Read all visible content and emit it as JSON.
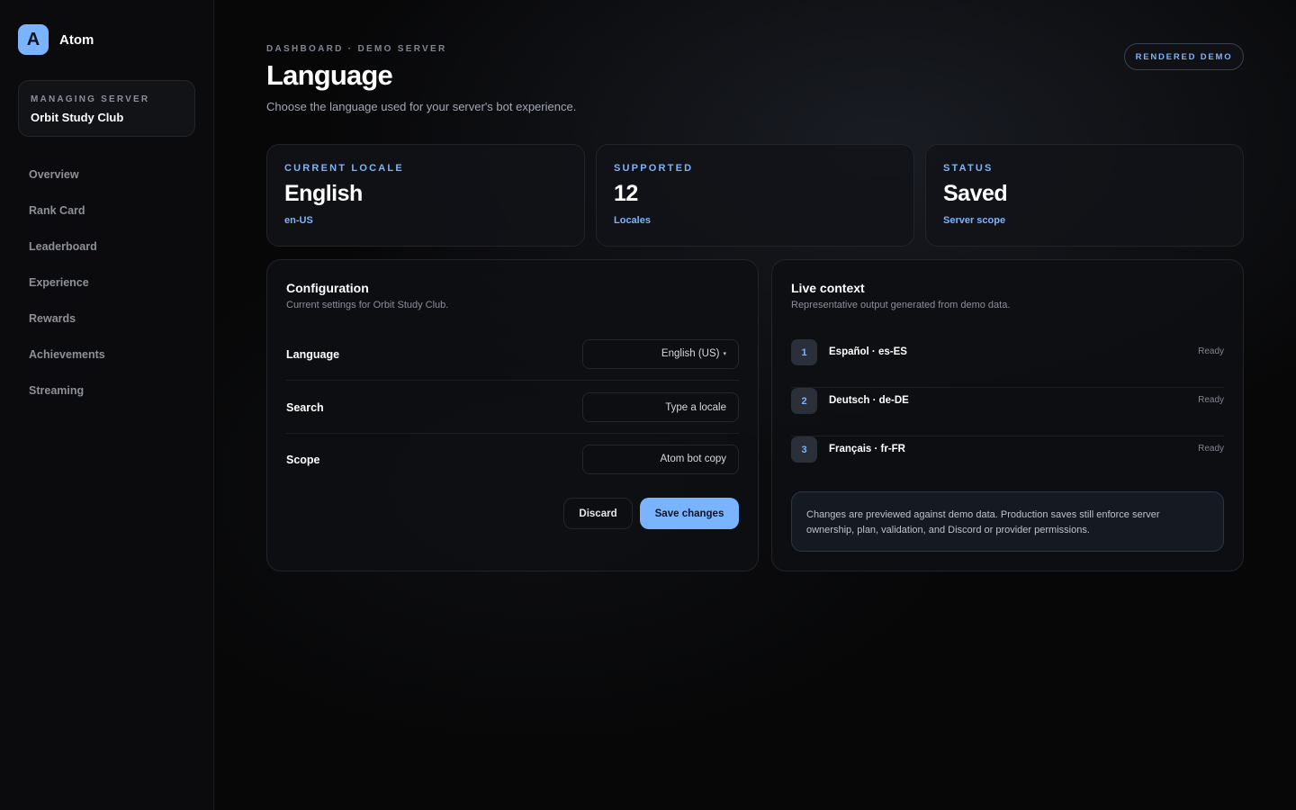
{
  "app": {
    "logo_letter": "A",
    "name": "Atom"
  },
  "server": {
    "label": "MANAGING SERVER",
    "name": "Orbit Study Club"
  },
  "nav": [
    "Overview",
    "Rank Card",
    "Leaderboard",
    "Experience",
    "Rewards",
    "Achievements",
    "Streaming"
  ],
  "header": {
    "breadcrumb": "DASHBOARD · DEMO SERVER",
    "title": "Language",
    "subtitle": "Choose the language used for your server's bot experience.",
    "badge": "RENDERED DEMO"
  },
  "stats": [
    {
      "label": "CURRENT LOCALE",
      "value": "English",
      "note": "en-US"
    },
    {
      "label": "SUPPORTED",
      "value": "12",
      "note": "Locales"
    },
    {
      "label": "STATUS",
      "value": "Saved",
      "note": "Server scope"
    }
  ],
  "config": {
    "title": "Configuration",
    "subtitle": "Current settings for Orbit Study Club.",
    "fields": [
      {
        "label": "Language",
        "value": "English (US)",
        "caret": "▾"
      },
      {
        "label": "Search",
        "placeholder": "Type a locale"
      },
      {
        "label": "Scope",
        "value": "Atom bot copy"
      }
    ],
    "discard_label": "Discard",
    "save_label": "Save changes"
  },
  "context": {
    "title": "Live context",
    "subtitle": "Representative output generated from demo data.",
    "items": [
      {
        "num": "1",
        "label": "Español · es-ES",
        "status": "Ready"
      },
      {
        "num": "2",
        "label": "Deutsch · de-DE",
        "status": "Ready"
      },
      {
        "num": "3",
        "label": "Français · fr-FR",
        "status": "Ready"
      }
    ],
    "notice": "Changes are previewed against demo data. Production saves still enforce server ownership, plan, validation, and Discord or provider permissions."
  },
  "colors": {
    "accent": "#7ab4ff",
    "background": "#070708",
    "panel": "#0e0f12"
  }
}
